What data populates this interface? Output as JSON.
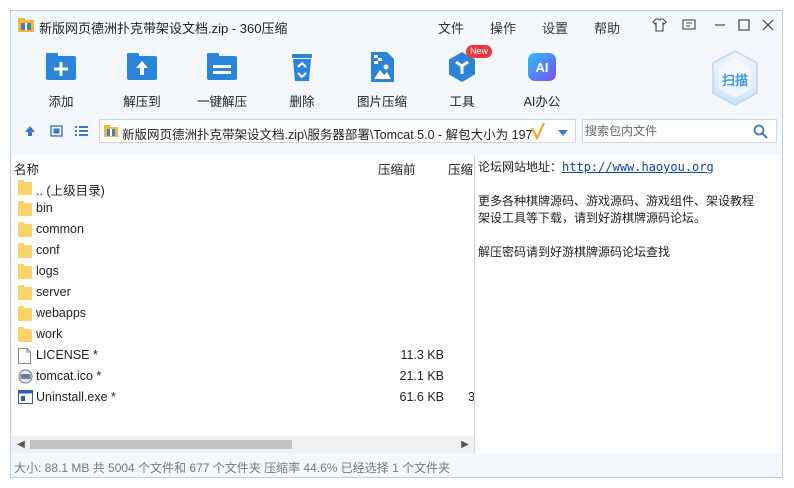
{
  "window": {
    "title": "新版网页德洲扑克带架设文档.zip - 360压缩",
    "menu": [
      "文件",
      "操作",
      "设置",
      "帮助"
    ]
  },
  "toolbar": {
    "items": [
      {
        "label": "添加",
        "icon": "add-icon"
      },
      {
        "label": "解压到",
        "icon": "extract-to-icon"
      },
      {
        "label": "一键解压",
        "icon": "one-click-extract-icon"
      },
      {
        "label": "删除",
        "icon": "recycle-bin-icon"
      },
      {
        "label": "图片压缩",
        "icon": "image-compress-icon"
      },
      {
        "label": "工具",
        "icon": "tools-icon"
      },
      {
        "label": "AI办公",
        "icon": "ai-office-icon"
      }
    ],
    "new_badge": "New",
    "ai_icon_text": "AI",
    "scan_label": "扫描"
  },
  "nav": {
    "address": "新版网页德洲扑克带架设文档.zip\\服务器部署\\Tomcat 5.0 - 解包大小为 197",
    "search_placeholder": "搜索包内文件"
  },
  "filelist": {
    "columns": {
      "name": "名称",
      "packed": "压缩前",
      "compressed": "压缩"
    },
    "rows": [
      {
        "name": ".. (上级目录)",
        "type": "folder",
        "packed": "",
        "compressed": ""
      },
      {
        "name": "bin",
        "type": "folder",
        "packed": "",
        "compressed": ""
      },
      {
        "name": "common",
        "type": "folder",
        "packed": "",
        "compressed": ""
      },
      {
        "name": "conf",
        "type": "folder",
        "packed": "",
        "compressed": ""
      },
      {
        "name": "logs",
        "type": "folder",
        "packed": "",
        "compressed": ""
      },
      {
        "name": "server",
        "type": "folder",
        "packed": "",
        "compressed": ""
      },
      {
        "name": "webapps",
        "type": "folder",
        "packed": "",
        "compressed": ""
      },
      {
        "name": "work",
        "type": "folder",
        "packed": "",
        "compressed": ""
      },
      {
        "name": "LICENSE *",
        "type": "file",
        "packed": "11.3 KB",
        "compressed": ""
      },
      {
        "name": "tomcat.ico *",
        "type": "ico",
        "packed": "21.1 KB",
        "compressed": ""
      },
      {
        "name": "Uninstall.exe *",
        "type": "exe",
        "packed": "61.6 KB",
        "compressed": "3"
      }
    ]
  },
  "info": {
    "forum_label": "论坛网站地址：",
    "forum_url": "http://www.haoyou.org",
    "line2": "更多各种棋牌源码、游戏源码、游戏组件、架设教程",
    "line3": "架设工具等下载，请到好游棋牌源码论坛。",
    "line4": "解压密码请到好游棋牌源码论坛查找"
  },
  "status": {
    "text": "大小: 88.1 MB 共 5004 个文件和 677 个文件夹 压缩率 44.6% 已经选择 1 个文件夹"
  },
  "colors": {
    "accent": "#2b83da",
    "window_bg": "#f4f8fd",
    "border": "#b9cde3"
  }
}
